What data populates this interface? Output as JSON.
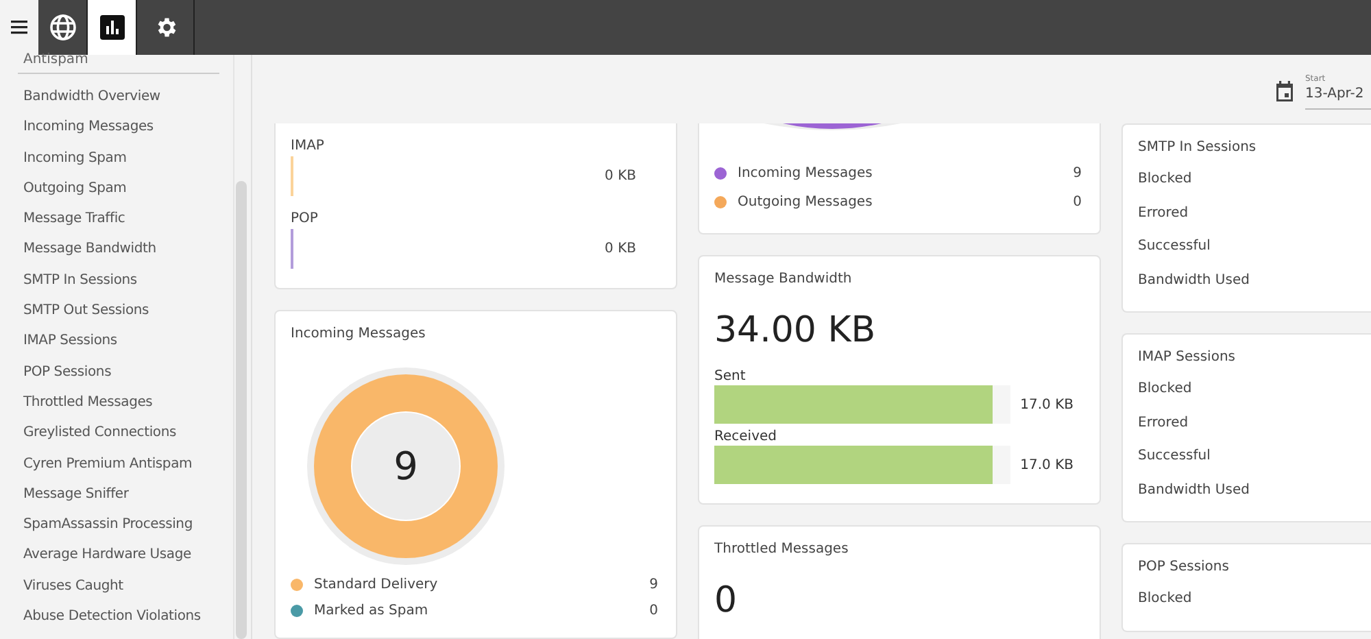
{
  "top_bar": {
    "tabs": [
      {
        "selected": false
      },
      {
        "selected": true
      },
      {
        "selected": false
      }
    ]
  },
  "sidebar": {
    "group": "Antispam",
    "items": [
      "Bandwidth Overview",
      "Incoming Messages",
      "Incoming Spam",
      "Outgoing Spam",
      "Message Traffic",
      "Message Bandwidth",
      "SMTP In Sessions",
      "SMTP Out Sessions",
      "IMAP Sessions",
      "POP Sessions",
      "Throttled Messages",
      "Greylisted Connections",
      "Cyren Premium Antispam",
      "Message Sniffer",
      "SpamAssassin Processing",
      "Average Hardware Usage",
      "Viruses Caught",
      "Abuse Detection Violations"
    ]
  },
  "date_filter": {
    "label": "Start",
    "value": "13-Apr-2"
  },
  "columns": [
    [
      {
        "kind": "protocols",
        "rows": [
          {
            "label": "IMAP",
            "value": "0 KB",
            "color": "#fbd39a"
          },
          {
            "label": "POP",
            "value": "0 KB",
            "color": "#b39ddb"
          }
        ]
      },
      {
        "kind": "donut",
        "title": "Incoming Messages",
        "total": "9",
        "legend": [
          {
            "label": "Standard Delivery",
            "value": "9",
            "color": "#f9b769"
          },
          {
            "label": "Marked as Spam",
            "value": "0",
            "color": "#4a9aa6"
          }
        ]
      }
    ],
    [
      {
        "kind": "legend_tail",
        "legend": [
          {
            "label": "Incoming Messages",
            "value": "9",
            "color": "#9c64d4"
          },
          {
            "label": "Outgoing Messages",
            "value": "0",
            "color": "#f4a85a"
          }
        ]
      },
      {
        "kind": "bandwidth",
        "title": "Message Bandwidth",
        "total": "34.00 KB",
        "bars": [
          {
            "label": "Sent",
            "value": "17.0 KB",
            "level": 0.94
          },
          {
            "label": "Received",
            "value": "17.0 KB",
            "level": 0.94
          }
        ]
      },
      {
        "kind": "big",
        "title": "Throttled Messages",
        "total": "0"
      }
    ],
    [
      {
        "kind": "list",
        "title": "SMTP In Sessions",
        "rows": [
          "Blocked",
          "Errored",
          "Successful",
          "Bandwidth Used"
        ]
      },
      {
        "kind": "list",
        "title": "IMAP Sessions",
        "rows": [
          "Blocked",
          "Errored",
          "Successful",
          "Bandwidth Used"
        ]
      },
      {
        "kind": "list",
        "title": "POP Sessions",
        "rows": [
          "Blocked"
        ]
      }
    ]
  ]
}
